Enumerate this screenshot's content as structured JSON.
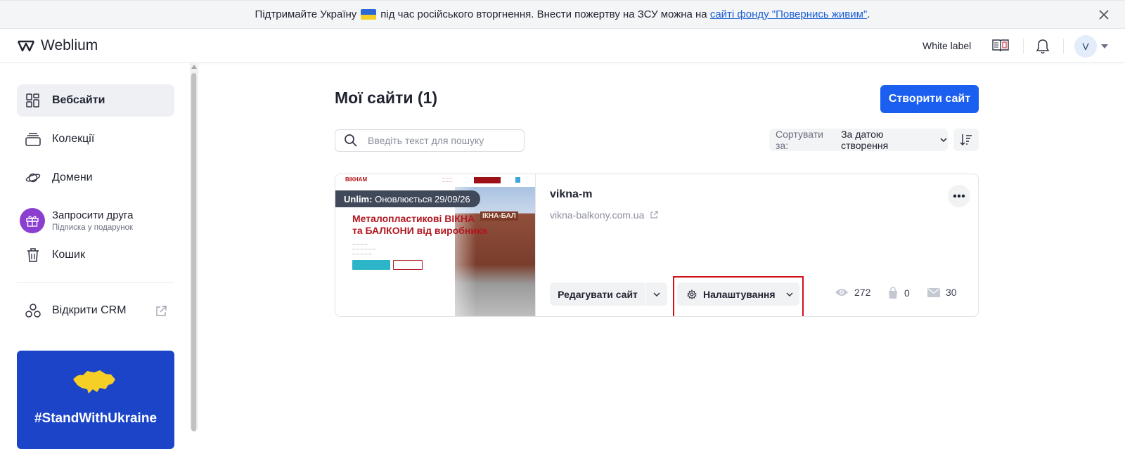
{
  "banner": {
    "text_before": "Підтримайте Україну",
    "text_middle": "під час російського вторгнення. Внести пожертву на ЗСУ можна на",
    "link_text": "сайті фонду \"Повернись живим\"",
    "text_after": "."
  },
  "header": {
    "logo_text": "Weblium",
    "white_label": "White label",
    "avatar_initial": "V"
  },
  "sidebar": {
    "items": [
      {
        "label": "Вебсайти",
        "icon": "grid-icon",
        "active": true
      },
      {
        "label": "Колекції",
        "icon": "stack-icon"
      },
      {
        "label": "Домени",
        "icon": "planet-icon"
      },
      {
        "label": "Кошик",
        "icon": "trash-icon"
      }
    ],
    "invite": {
      "title": "Запросити друга",
      "subtitle": "Підписка у подарунок"
    },
    "crm_label": "Відкрити CRM",
    "ukraine_tag": "#StandWithUkraine"
  },
  "main": {
    "title": "Мої сайти (1)",
    "create_button": "Створити сайт",
    "search_placeholder": "Введіть текст для пошуку",
    "sort_label": "Сортувати за:",
    "sort_value": "За датою створення"
  },
  "site": {
    "name": "vikna-m",
    "url": "vikna-balkony.com.ua",
    "plan_badge_strong": "Unlim:",
    "plan_badge_text": "Оновлюється 29/09/26",
    "preview": {
      "brand": "ВІКНАМ",
      "headline_line1": "Металопластикові ВІКНА",
      "headline_line2": "та БАЛКОНИ від виробника",
      "building_sign": "ІКНА-БАЛ"
    },
    "edit_button": "Редагувати сайт",
    "settings_button": "Налаштування",
    "stats": {
      "views": "272",
      "orders": "0",
      "messages": "30"
    }
  },
  "colors": {
    "accent": "#1a5ff0",
    "highlight": "#d0131a",
    "invite_gift": "#8a3fd1",
    "ukraine_card": "#1b44c8"
  }
}
